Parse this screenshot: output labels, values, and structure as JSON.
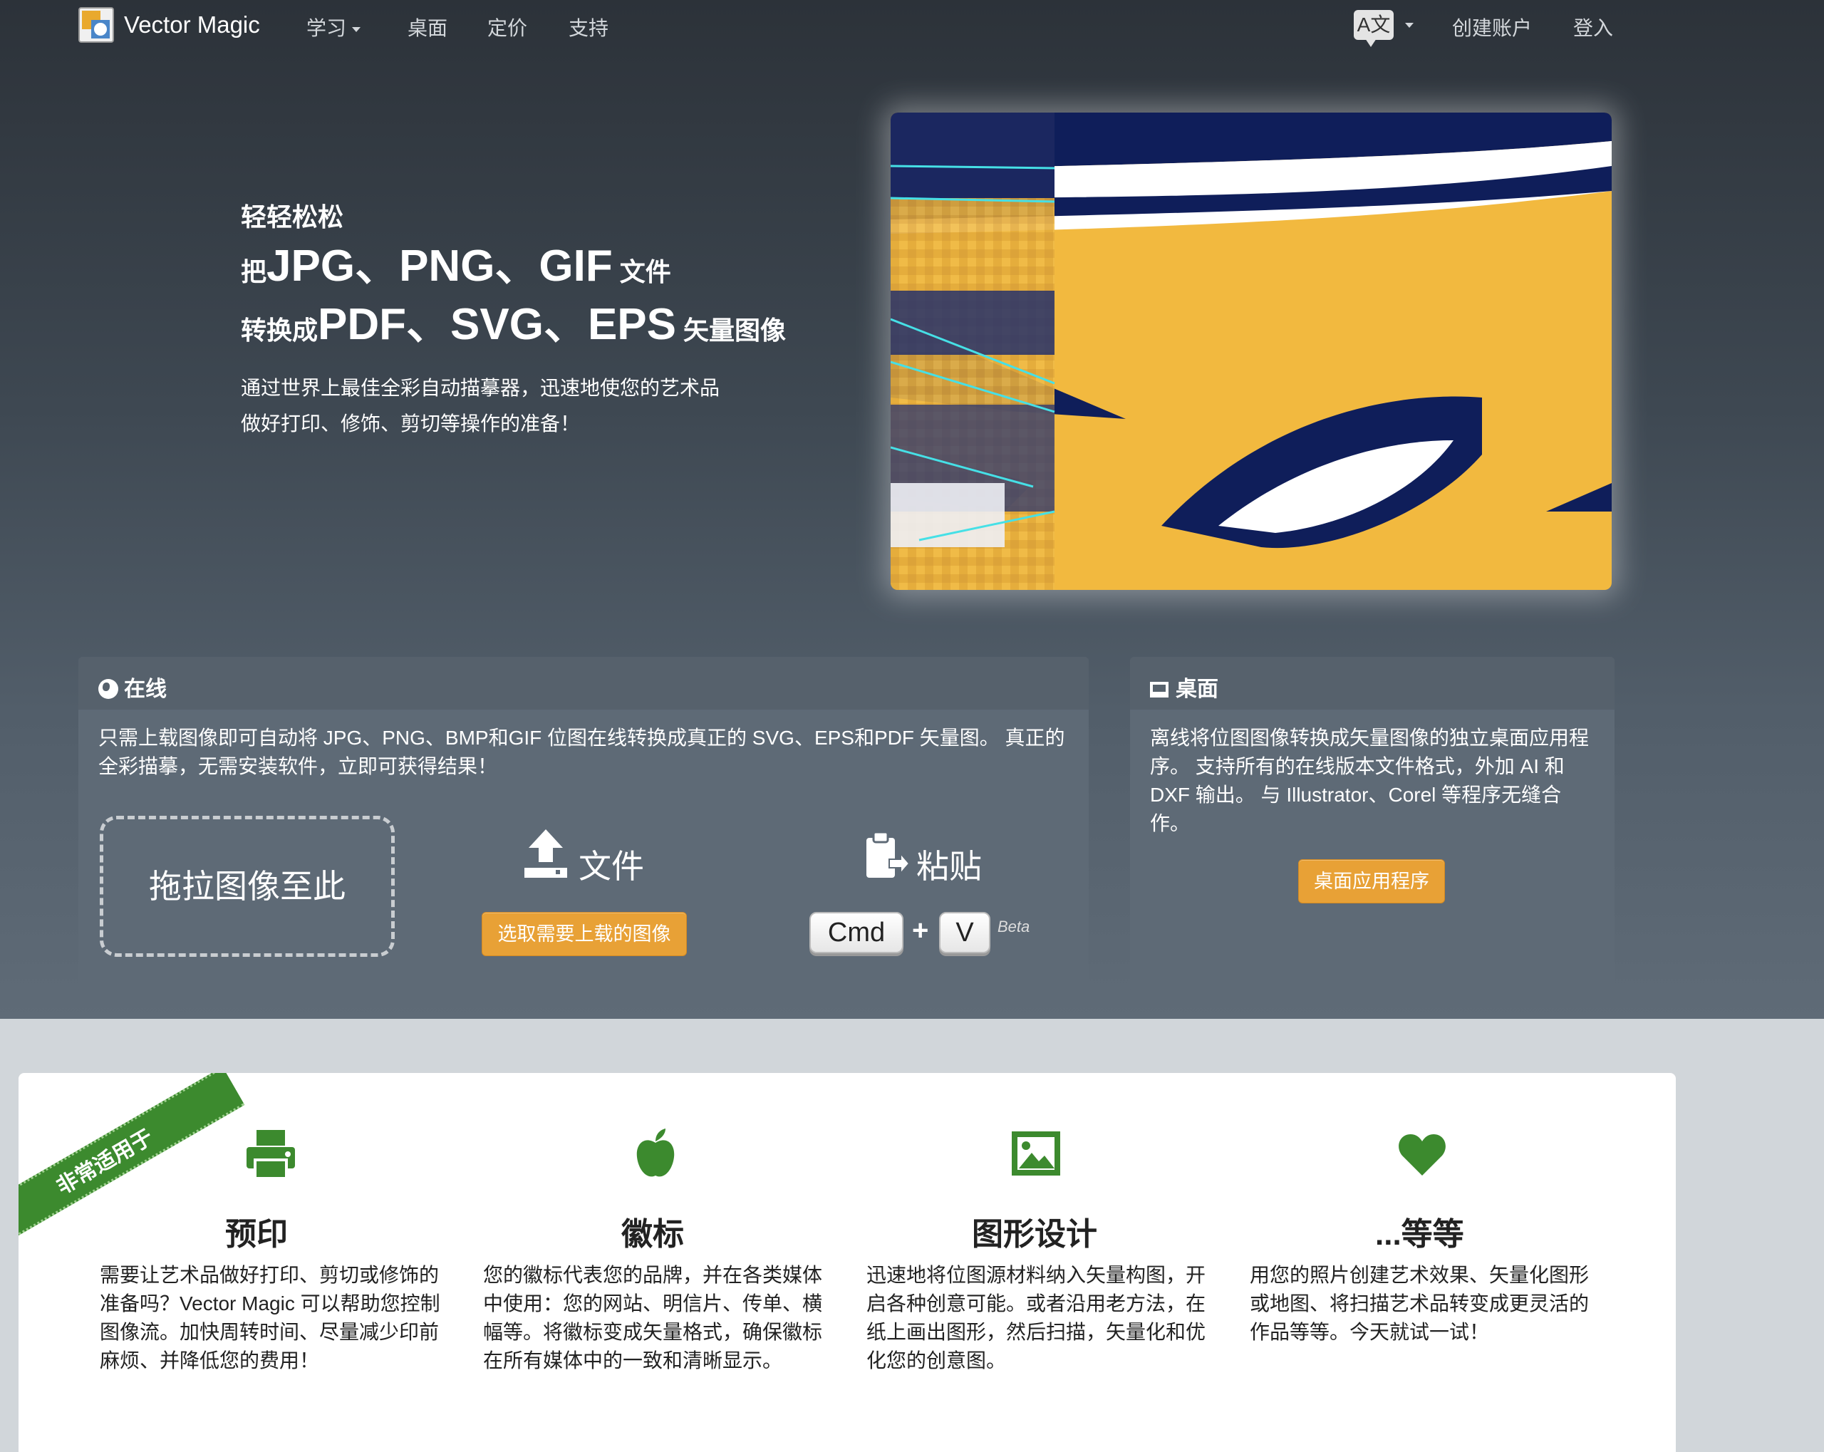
{
  "nav": {
    "brand": "Vector Magic",
    "links": {
      "learn": "学习",
      "desktop": "桌面",
      "pricing": "定价",
      "support": "支持"
    },
    "lang_glyph": "A文",
    "create_account": "创建账户",
    "login": "登入"
  },
  "hero": {
    "eyebrow": "轻轻松松",
    "line1_pre": "把",
    "line1_formats": "JPG、PNG、GIF",
    "line1_post": "文件",
    "line2_pre": "转换成",
    "line2_formats": "PDF、SVG、EPS",
    "line2_post": "矢量图像",
    "description": "通过世界上最佳全彩自动描摹器，迅速地使您的艺术品做好打印、修饰、剪切等操作的准备！"
  },
  "online_panel": {
    "title": "在线",
    "text": "只需上载图像即可自动将 JPG、PNG、BMP和GIF 位图在线转换成真正的 SVG、EPS和PDF 矢量图。 真正的全彩描摹，无需安装软件，立即可获得结果！",
    "dropzone": "拖拉图像至此",
    "file_label": "文件",
    "file_button": "选取需要上载的图像",
    "paste_label": "粘贴",
    "key_cmd": "Cmd",
    "key_plus": "+",
    "key_v": "V",
    "beta": "Beta"
  },
  "desktop_panel": {
    "title": "桌面",
    "text": "离线将位图图像转换成矢量图像的独立桌面应用程序。 支持所有的在线版本文件格式，外加 AI 和 DXF 输出。 与 Illustrator、Corel 等程序无缝合作。",
    "button": "桌面应用程序"
  },
  "features": {
    "ribbon": "非常适用于",
    "items": [
      {
        "icon": "printer-icon",
        "title": "预印",
        "text": "需要让艺术品做好打印、剪切或修饰的准备吗？Vector Magic 可以帮助您控制图像流。加快周转时间、尽量减少印前麻烦、并降低您的费用！"
      },
      {
        "icon": "apple-icon",
        "title": "徽标",
        "text": "您的徽标代表您的品牌，并在各类媒体中使用：您的网站、明信片、传单、横幅等。将徽标变成矢量格式，确保徽标在所有媒体中的一致和清晰显示。"
      },
      {
        "icon": "picture-icon",
        "title": "图形设计",
        "text": "迅速地将位图源材料纳入矢量构图，开启各种创意可能。或者沿用老方法，在纸上画出图形，然后扫描，矢量化和优化您的创意图。"
      },
      {
        "icon": "heart-icon",
        "title": "...等等",
        "text": "用您的照片创建艺术效果、矢量化图形或地图、将扫描艺术品转变成更灵活的作品等等。今天就试一试！"
      }
    ]
  },
  "colors": {
    "accent_orange": "#e8a136",
    "ribbon_green": "#3c8a2e",
    "icon_green": "#3c8a2e",
    "art_yellow": "#f2b93f",
    "art_navy": "#0f1e5a"
  }
}
